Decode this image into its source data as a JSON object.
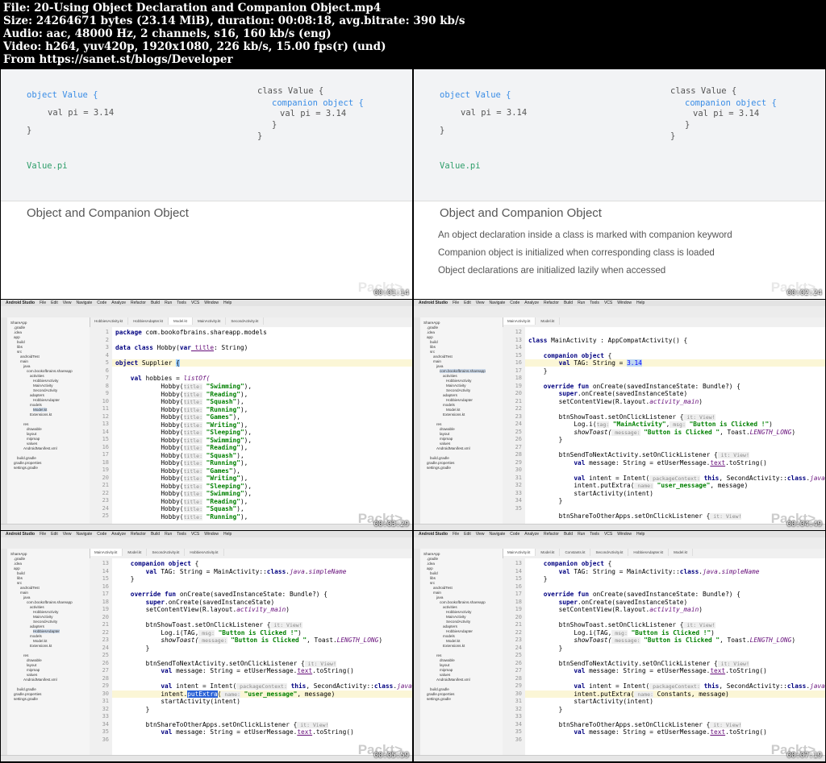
{
  "header": {
    "line1": "File: 20-Using Object Declaration and Companion Object.mp4",
    "line2": "Size: 24264671 bytes (23.14 MiB), duration: 00:08:18, avg.bitrate: 390 kb/s",
    "line3": "Audio: aac, 48000 Hz, 2 channels, s16, 160 kb/s (eng)",
    "line4": "Video: h264, yuv420p, 1920x1080, 226 kb/s, 15.00 fps(r) (und)",
    "line5": "From https://sanet.st/blogs/Developer"
  },
  "slide1": {
    "code_left": [
      "object Value {",
      "val pi = 3.14",
      "}",
      "Value.pi"
    ],
    "code_right": [
      "class Value {",
      "companion object {",
      "val pi = 3.14",
      "}",
      "}"
    ],
    "title": "Object and Companion Object",
    "logo": "Packt>",
    "timestamp": "00:01:14"
  },
  "slide2": {
    "code_left": [
      "object Value {",
      "val pi = 3.14",
      "}",
      "Value.pi"
    ],
    "code_right": [
      "class Value {",
      "companion object {",
      "val pi = 3.14",
      "}",
      "}"
    ],
    "title": "Object and Companion Object",
    "bullets": [
      "An object declaration inside a class is marked with companion keyword",
      "Companion object is initialized when corresponding class is loaded",
      "Object declarations are initialized lazily when accessed"
    ],
    "logo": "Packt>",
    "timestamp": "00:02:24"
  },
  "ide": {
    "menu": [
      "Android Studio",
      "File",
      "Edit",
      "View",
      "Navigate",
      "Code",
      "Analyze",
      "Refactor",
      "Build",
      "Run",
      "Tools",
      "VCS",
      "Window",
      "Help"
    ],
    "project_items": [
      "ShareApp",
      ".gradle",
      ".idea",
      "app",
      "build",
      "libs",
      "src",
      "androidTest",
      "main",
      "java",
      "com.bookofbrains.shareapp",
      "activities",
      "HobbiesActivity",
      "MainActivity",
      "SecondActivity",
      "adapters",
      "HobbiesAdapter",
      "models",
      "Model.kt",
      "Extensions.kt",
      "res",
      "drawable",
      "layout",
      "mipmap",
      "values",
      "AndroidManifest.xml",
      "build.gradle",
      "gradle.properties",
      "settings.gradle"
    ]
  },
  "ide1": {
    "tabs": [
      "HobbiesActivity.kt",
      "HobbiesAdapter.kt",
      "Model.kt",
      "MainActivity.kt",
      "SecondActivity.kt"
    ],
    "line_numbers": [
      "1",
      "2",
      "3",
      "4",
      "5",
      "6",
      "7",
      "8",
      "9",
      "10",
      "11",
      "12",
      "13",
      "14",
      "15",
      "16",
      "17",
      "18",
      "19",
      "20",
      "21",
      "22",
      "23",
      "24",
      "25"
    ],
    "code": {
      "l1_kw": "package",
      "l1_rest": " com.bookofbrains.shareapp.models",
      "l3_kw": "data class",
      "l3_mid": " Hobby(",
      "l3_kw2": "var",
      "l3_p": " title",
      "l3_rest": ": String)",
      "l5_kw": "object",
      "l5_rest": " Supplier ",
      "l7_kw": "val",
      "l7_mid": " hobbies = ",
      "l7_fn": "listOf(",
      "hobbies": [
        "Swimming",
        "Reading",
        "Squash",
        "Running",
        "Games",
        "Writing",
        "Sleeping",
        "Swimming",
        "Reading",
        "Squash",
        "Running",
        "Games",
        "Writing",
        "Sleeping",
        "Swimming",
        "Reading",
        "Squash",
        "Running"
      ],
      "hint": "title:"
    },
    "timestamp": "00:03:29"
  },
  "ide2": {
    "tabs": [
      "MainActivity.kt",
      "Model.kt"
    ],
    "line_numbers": [
      "12",
      "13",
      "14",
      "15",
      "16",
      "17",
      "18",
      "19",
      "20",
      "21",
      "22",
      "23",
      "24",
      "25",
      "26",
      "27",
      "28",
      "29",
      "30",
      "31",
      "32",
      "33",
      "34",
      "35"
    ],
    "code": {
      "l13_kw": "class",
      "l13_rest": " MainActivity : AppCompatActivity() {",
      "l14_kw": "companion object",
      "l14_rest": " {",
      "l15_kw": "val",
      "l15_mid": " TAG: String = ",
      "l15_val": "3.14",
      "l16": "}",
      "l18_kw": "override fun",
      "l18_rest": " onCreate(savedInstanceState: Bundle?) {",
      "l19_kw": "super",
      "l19_rest": ".onCreate(savedInstanceState)",
      "l20_a": "setContentView(R.layout.",
      "l20_i": "activity_main",
      "l20_b": ")",
      "l22_a": "btnShowToast.setOnClickListener {",
      "l22_h": " it: View!",
      "l23_a": "Log.i(",
      "l23_h": "tag:",
      "l23_s": " \"MainActivity\"",
      "l23_h2": " msg:",
      "l23_s2": " \"Button is Clicked !\"",
      "l23_b": ")",
      "l24_i": "showToast(",
      "l24_h": " message:",
      "l24_s": " \"Button is Clicked \"",
      "l24_b": ", Toast.",
      "l24_i2": "LENGTH_LONG",
      "l24_c": ")",
      "l25": "}",
      "l27_a": "btnSendToNextActivity.setOnClickListener {",
      "l27_h": " it: View!",
      "l28_kw": "val",
      "l28_a": " message: String = etUserMessage.",
      "l28_u": "text",
      "l28_b": ".toString()",
      "l30_kw": "val",
      "l30_a": " intent = Intent(",
      "l30_h": " packageContext:",
      "l30_kw2": " this",
      "l30_b": ", SecondActivity::",
      "l30_kw3": "class",
      "l30_c": ".",
      "l30_i": "java",
      "l30_d": ")",
      "l31_a": "intent.putExtra(",
      "l31_h": " name:",
      "l31_s": " \"user_message\"",
      "l31_b": ", message)",
      "l32": "startActivity(intent)",
      "l33": "}",
      "l35_a": "btnShareToOtherApps.setOnClickListener {",
      "l35_h": " it: View!"
    },
    "timestamp": "00:04:49"
  },
  "ide3": {
    "tabs": [
      "MainActivity.kt",
      "Model.kt",
      "SecondActivity.kt",
      "HobbiesActivity.kt"
    ],
    "line_numbers": [
      "13",
      "14",
      "15",
      "16",
      "17",
      "18",
      "19",
      "20",
      "21",
      "22",
      "23",
      "24",
      "25",
      "26",
      "27",
      "28",
      "29",
      "30",
      "31",
      "32",
      "33",
      "34",
      "35",
      "36"
    ],
    "code": {
      "l13_kw": "companion object",
      "l13_rest": " {",
      "l14_kw": "val",
      "l14_mid": " TAG: String = MainActivity::",
      "l14_kw2": "class",
      "l14_c": ".",
      "l14_i": "java",
      "l14_d": ".",
      "l14_i2": "simpleName",
      "l15": "}",
      "l17_kw": "override fun",
      "l17_rest": " onCreate(savedInstanceState: Bundle?) {",
      "l18_kw": "super",
      "l18_rest": ".onCreate(savedInstanceState)",
      "l19_a": "setContentView(R.layout.",
      "l19_i": "activity_main",
      "l19_b": ")",
      "l21_a": "btnShowToast.setOnClickListener {",
      "l21_h": " it: View!",
      "l22_a": "Log.i(TAG,",
      "l22_h": " msg:",
      "l22_s": " \"Button is Clicked !\"",
      "l22_b": ")",
      "l23_i": "showToast(",
      "l23_h": " message:",
      "l23_s": " \"Button is Clicked \"",
      "l23_b": ", Toast.",
      "l23_i2": "LENGTH_LONG",
      "l23_c": ")",
      "l24": "}",
      "l26_a": "btnSendToNextActivity.setOnClickListener {",
      "l26_h": " it: View!",
      "l27_kw": "val",
      "l27_a": " message: String = etUserMessage.",
      "l27_u": "text",
      "l27_b": ".toString()",
      "l29_kw": "val",
      "l29_a": " intent = Intent(",
      "l29_h": " packageContext:",
      "l29_kw2": " this",
      "l29_b": ", SecondActivity::",
      "l29_kw3": "class",
      "l29_c": ".",
      "l29_i": "java",
      "l29_d": ")",
      "l30_a": "intent.",
      "l30_sel": "putExtra",
      "l30_p": "(",
      "l30_h": " name:",
      "l30_s": " \"user_message\"",
      "l30_b": ", message)",
      "l31": "startActivity(intent)",
      "l32": "}",
      "l34_a": "btnShareToOtherApps.setOnClickListener {",
      "l34_h": " it: View!",
      "l35_kw": "val",
      "l35_a": " message: String = etUserMessage.",
      "l35_u": "text",
      "l35_b": ".toString()"
    },
    "timestamp": "00:05:59"
  },
  "ide4": {
    "tabs": [
      "MainActivity.kt",
      "Model.kt",
      "Constants.kt",
      "SecondActivity.kt",
      "HobbiesAdapter.kt",
      "Model.kt"
    ],
    "line_numbers": [
      "13",
      "14",
      "15",
      "16",
      "17",
      "18",
      "19",
      "20",
      "21",
      "22",
      "23",
      "24",
      "25",
      "26",
      "27",
      "28",
      "29",
      "30",
      "31",
      "32",
      "33",
      "34",
      "35",
      "36"
    ],
    "code": {
      "l13_kw": "companion object",
      "l13_rest": " {",
      "l14_kw": "val",
      "l14_mid": " TAG: String = MainActivity::",
      "l14_kw2": "class",
      "l14_c": ".",
      "l14_i": "java",
      "l14_d": ".",
      "l14_i2": "simpleName",
      "l15": "}",
      "l17_kw": "override fun",
      "l17_rest": " onCreate(savedInstanceState: Bundle?) {",
      "l18_kw": "super",
      "l18_rest": ".onCreate(savedInstanceState)",
      "l19_a": "setContentView(R.layout.",
      "l19_i": "activity_main",
      "l19_b": ")",
      "l21_a": "btnShowToast.setOnClickListener {",
      "l21_h": " it: View!",
      "l22_a": "Log.i(TAG,",
      "l22_h": " msg:",
      "l22_s": " \"Button is Clicked !\"",
      "l22_b": ")",
      "l23_i": "showToast(",
      "l23_h": " message:",
      "l23_s": " \"Button is Clicked \"",
      "l23_b": ", Toast.",
      "l23_i2": "LENGTH_LONG",
      "l23_c": ")",
      "l24": "}",
      "l26_a": "btnSendToNextActivity.setOnClickListener {",
      "l26_h": " it: View!",
      "l27_kw": "val",
      "l27_a": " message: String = etUserMessage.",
      "l27_u": "text",
      "l27_b": ".toString()",
      "l29_kw": "val",
      "l29_a": " intent = Intent(",
      "l29_h": " packageContext:",
      "l29_kw2": " this",
      "l29_b": ", SecondActivity::",
      "l29_kw3": "class",
      "l29_c": ".",
      "l29_i": "java",
      "l29_d": ")",
      "l30_a": "intent.putExtra(",
      "l30_h": " name:",
      "l30_b": " Constants",
      "l30_c": ", message)",
      "l31": "startActivity(intent)",
      "l32": "}",
      "l34_a": "btnShareToOtherApps.setOnClickListener {",
      "l34_h": " it: View!",
      "l35_kw": "val",
      "l35_a": " message: String = etUserMessage.",
      "l35_u": "text",
      "l35_b": ".toString()"
    },
    "timestamp": "00:07:19"
  }
}
